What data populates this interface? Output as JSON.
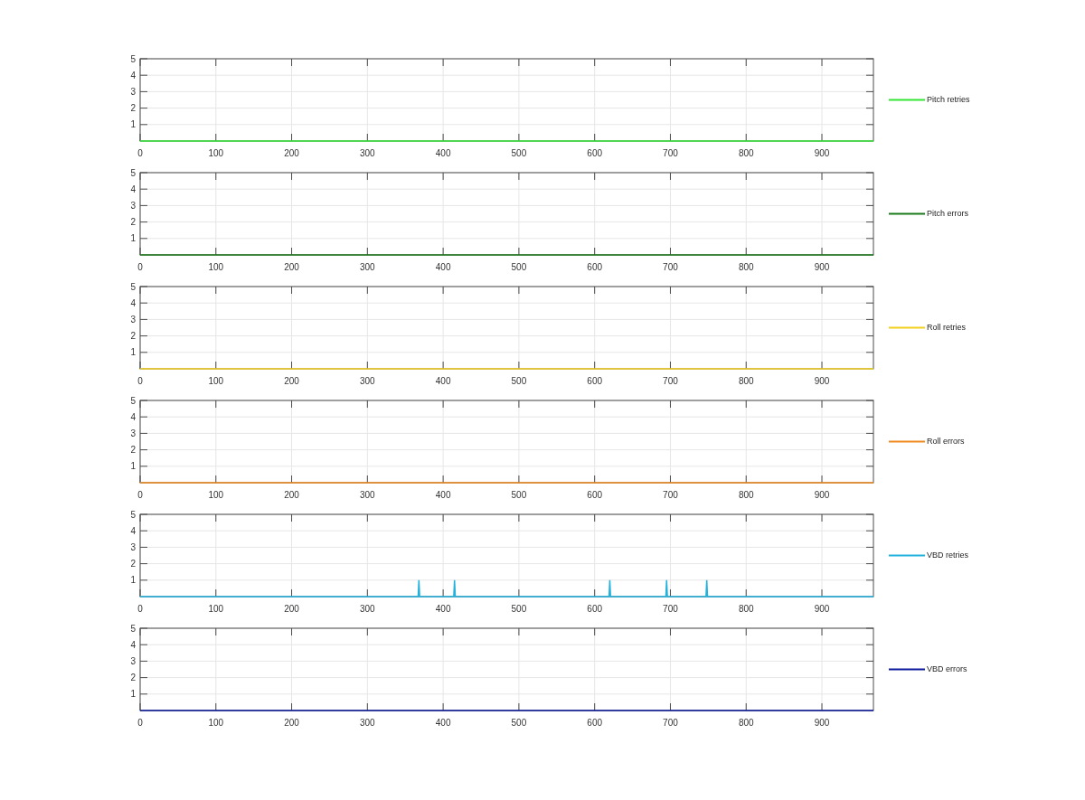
{
  "subplots": [
    {
      "chart_data": {
        "type": "line",
        "x": [
          0,
          968
        ],
        "series": [
          {
            "name": "Pitch retries",
            "color": "#33e633",
            "values": [
              0,
              0
            ]
          }
        ],
        "xlim": [
          0,
          968
        ],
        "ylim": [
          0,
          5
        ],
        "xticks": [
          0,
          100,
          200,
          300,
          400,
          500,
          600,
          700,
          800,
          900
        ],
        "yticks": [
          1,
          2,
          3,
          4,
          5
        ],
        "grid": true
      }
    },
    {
      "chart_data": {
        "type": "line",
        "x": [
          0,
          968
        ],
        "series": [
          {
            "name": "Pitch errors",
            "color": "#1b7a1b",
            "values": [
              0,
              0
            ]
          }
        ],
        "xlim": [
          0,
          968
        ],
        "ylim": [
          0,
          5
        ],
        "xticks": [
          0,
          100,
          200,
          300,
          400,
          500,
          600,
          700,
          800,
          900
        ],
        "yticks": [
          1,
          2,
          3,
          4,
          5
        ],
        "grid": true
      }
    },
    {
      "chart_data": {
        "type": "line",
        "x": [
          0,
          968
        ],
        "series": [
          {
            "name": "Roll retries",
            "color": "#f2d01c",
            "values": [
              0,
              0
            ]
          }
        ],
        "xlim": [
          0,
          968
        ],
        "ylim": [
          0,
          5
        ],
        "xticks": [
          0,
          100,
          200,
          300,
          400,
          500,
          600,
          700,
          800,
          900
        ],
        "yticks": [
          1,
          2,
          3,
          4,
          5
        ],
        "grid": true
      }
    },
    {
      "chart_data": {
        "type": "line",
        "x": [
          0,
          968
        ],
        "series": [
          {
            "name": "Roll errors",
            "color": "#f08a1e",
            "values": [
              0,
              0
            ]
          }
        ],
        "xlim": [
          0,
          968
        ],
        "ylim": [
          0,
          5
        ],
        "xticks": [
          0,
          100,
          200,
          300,
          400,
          500,
          600,
          700,
          800,
          900
        ],
        "yticks": [
          1,
          2,
          3,
          4,
          5
        ],
        "grid": true
      }
    },
    {
      "chart_data": {
        "type": "line",
        "x": [
          0,
          367,
          368,
          369,
          414,
          415,
          416,
          619,
          620,
          621,
          694,
          695,
          696,
          747,
          748,
          749,
          968
        ],
        "series": [
          {
            "name": "VBD retries",
            "color": "#22b2de",
            "values": [
              0,
              0,
              1,
              0,
              0,
              1,
              0,
              0,
              1,
              0,
              0,
              1,
              0,
              0,
              1,
              0,
              0
            ]
          }
        ],
        "xlim": [
          0,
          968
        ],
        "ylim": [
          0,
          5
        ],
        "xticks": [
          0,
          100,
          200,
          300,
          400,
          500,
          600,
          700,
          800,
          900
        ],
        "yticks": [
          1,
          2,
          3,
          4,
          5
        ],
        "grid": true
      }
    },
    {
      "chart_data": {
        "type": "line",
        "x": [
          0,
          968
        ],
        "series": [
          {
            "name": "VBD errors",
            "color": "#0d1a9e",
            "values": [
              0,
              0
            ]
          }
        ],
        "xlim": [
          0,
          968
        ],
        "ylim": [
          0,
          5
        ],
        "xticks": [
          0,
          100,
          200,
          300,
          400,
          500,
          600,
          700,
          800,
          900
        ],
        "yticks": [
          1,
          2,
          3,
          4,
          5
        ],
        "grid": true
      }
    }
  ]
}
